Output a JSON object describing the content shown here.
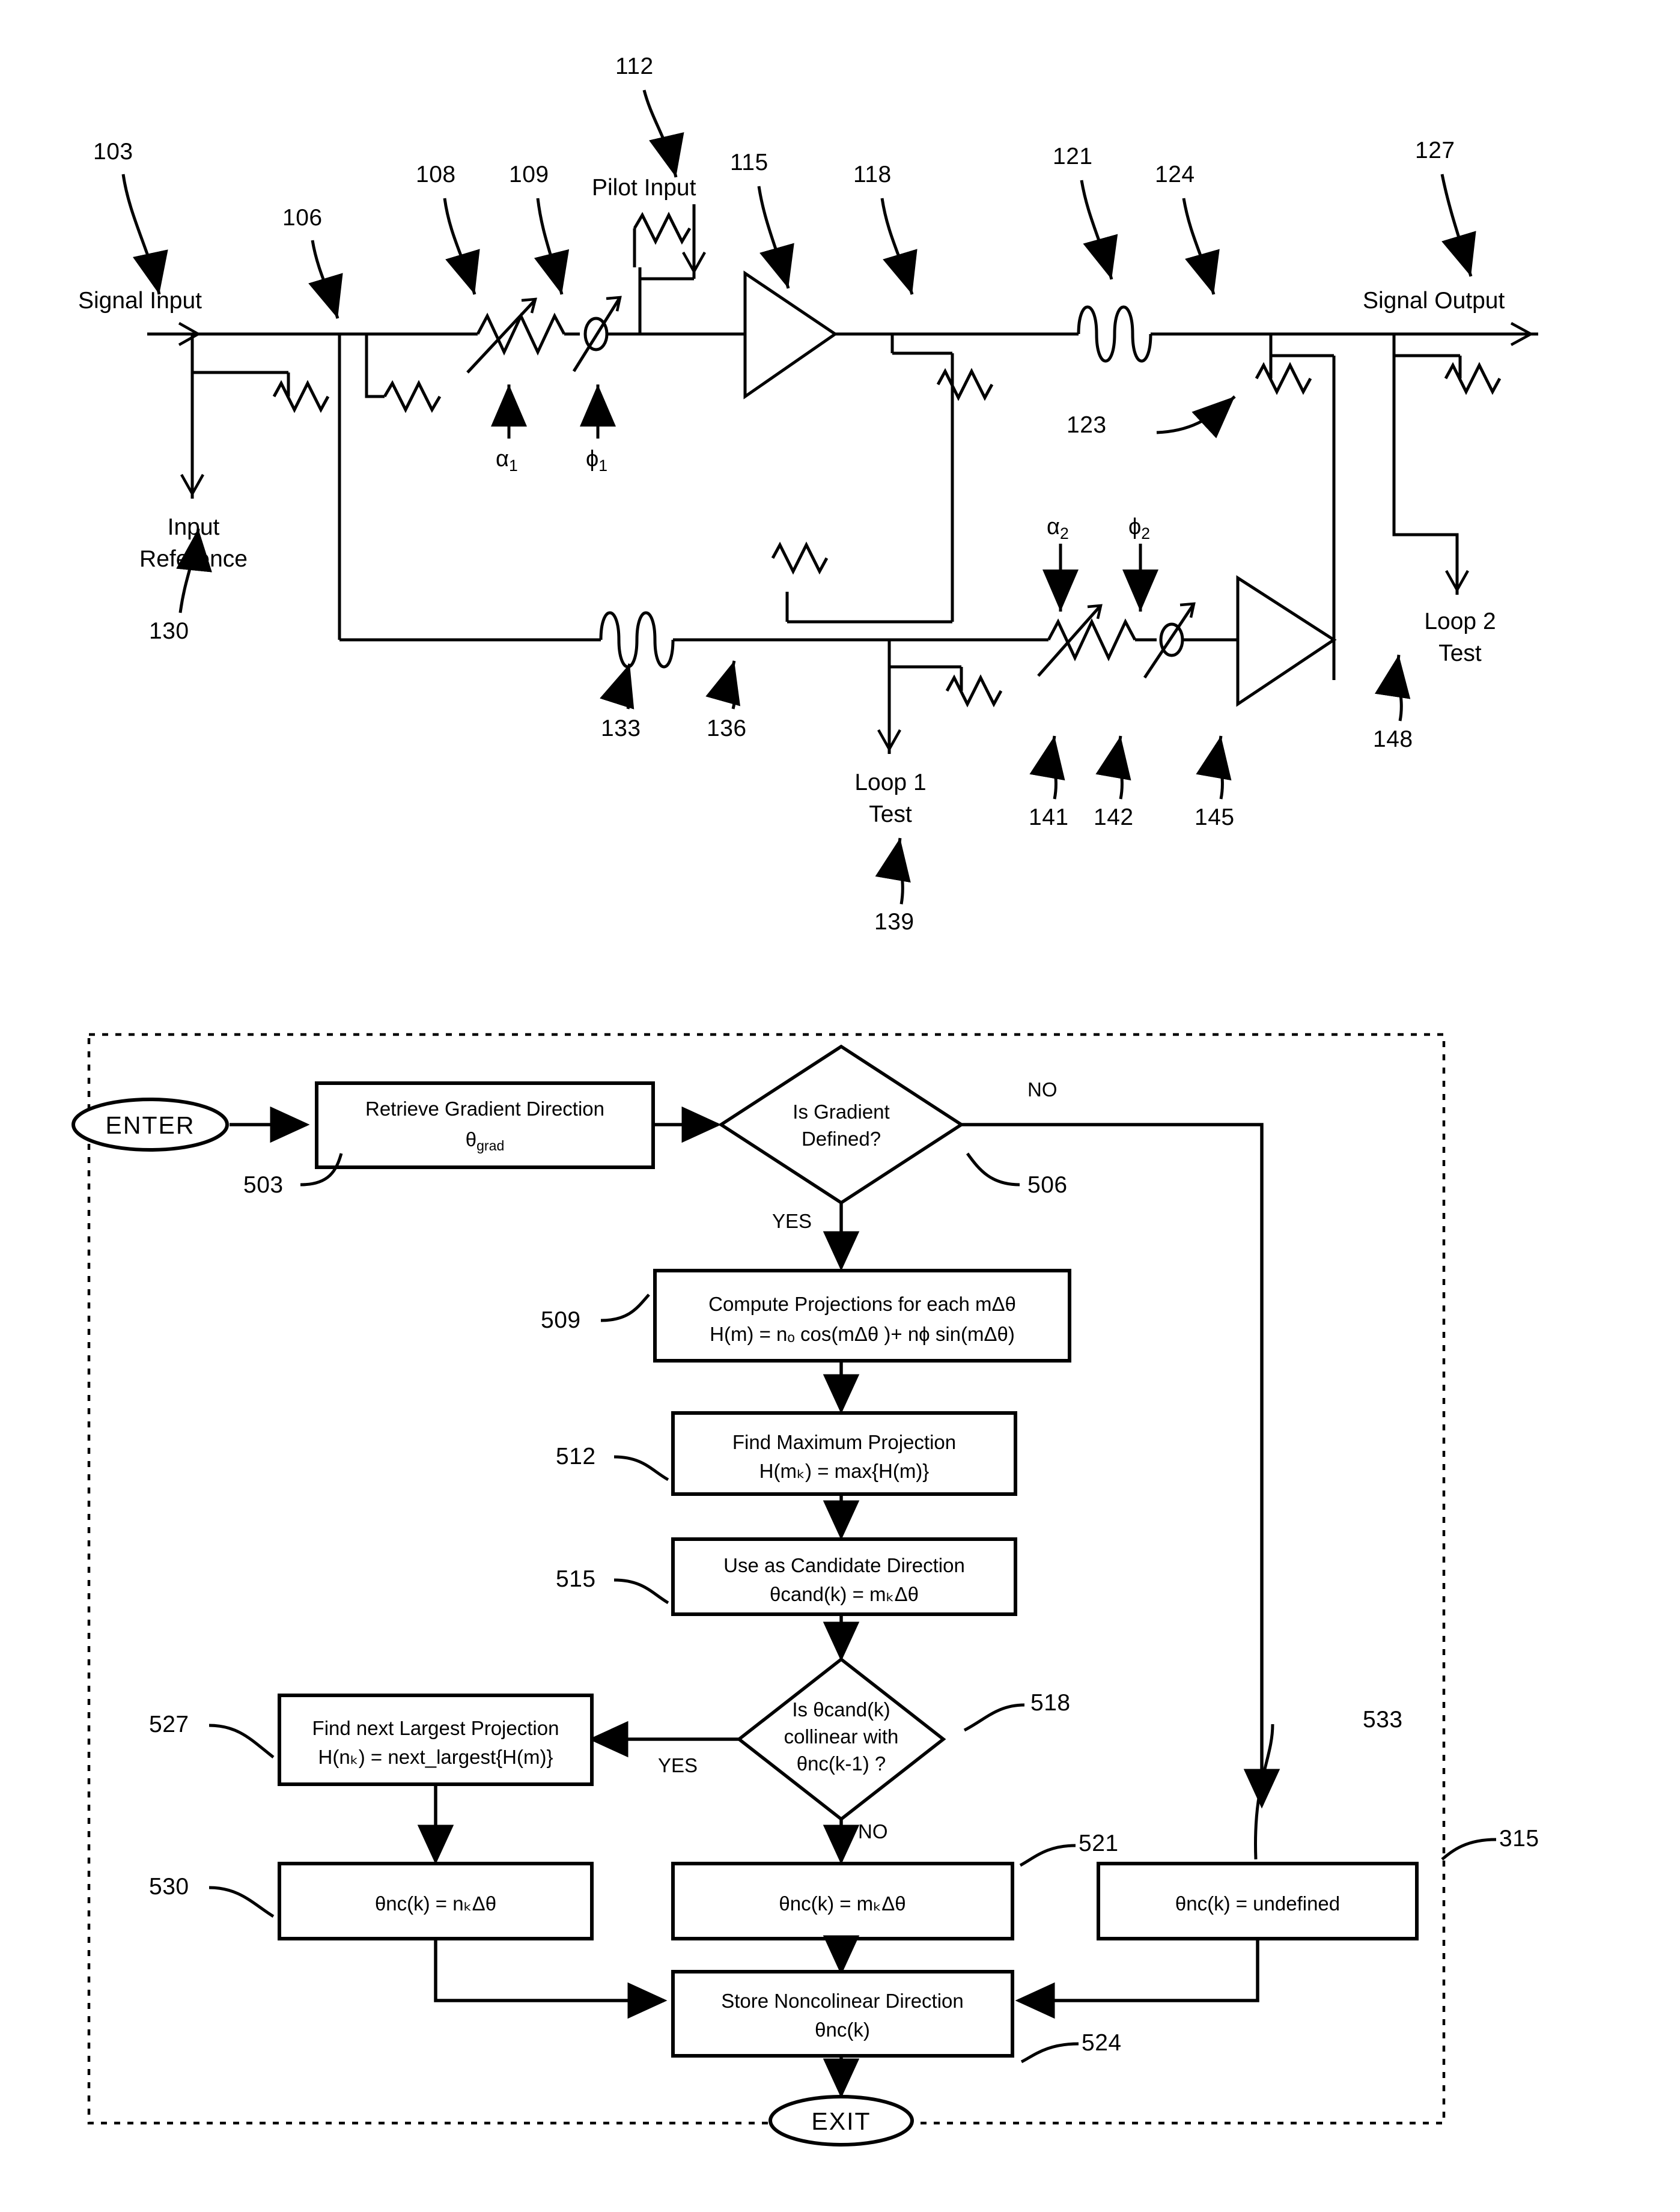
{
  "figure1": {
    "name": "feedforward-amplifier-circuit",
    "terminals": {
      "signal_input": "Signal Input",
      "signal_output": "Signal Output",
      "pilot_input": "Pilot Input",
      "input_reference": "Input\nReference",
      "loop1_test": "Loop 1\nTest",
      "loop2_test": "Loop 2\nTest"
    },
    "terminal_lines": {
      "input_reference_l1": "Input",
      "input_reference_l2": "Reference",
      "loop1_test_l1": "Loop 1",
      "loop1_test_l2": "Test",
      "loop2_test_l1": "Loop 2",
      "loop2_test_l2": "Test"
    },
    "symbols": {
      "alpha1": "α",
      "alpha1_sub": "1",
      "phi1": "ϕ",
      "phi1_sub": "1",
      "alpha2": "α",
      "alpha2_sub": "2",
      "phi2": "ϕ",
      "phi2_sub": "2"
    },
    "refs": [
      {
        "id": "103",
        "label": "103"
      },
      {
        "id": "106",
        "label": "106"
      },
      {
        "id": "108",
        "label": "108"
      },
      {
        "id": "109",
        "label": "109"
      },
      {
        "id": "112",
        "label": "112"
      },
      {
        "id": "115",
        "label": "115"
      },
      {
        "id": "118",
        "label": "118"
      },
      {
        "id": "121",
        "label": "121"
      },
      {
        "id": "123",
        "label": "123"
      },
      {
        "id": "124",
        "label": "124"
      },
      {
        "id": "127",
        "label": "127"
      },
      {
        "id": "130",
        "label": "130"
      },
      {
        "id": "133",
        "label": "133"
      },
      {
        "id": "136",
        "label": "136"
      },
      {
        "id": "139",
        "label": "139"
      },
      {
        "id": "141",
        "label": "141"
      },
      {
        "id": "142",
        "label": "142"
      },
      {
        "id": "145",
        "label": "145"
      },
      {
        "id": "148",
        "label": "148"
      }
    ]
  },
  "figure2": {
    "name": "noncolinear-direction-flowchart",
    "enter_label": "ENTER",
    "exit_label": "EXIT",
    "nodes": {
      "retrieve_gradient": {
        "line1": "Retrieve Gradient Direction",
        "line2_pre": "θ",
        "line2_sub": "grad",
        "ref": "503"
      },
      "is_gradient_defined": {
        "line1": "Is Gradient",
        "line2": "Defined?",
        "ref": "506"
      },
      "compute_projections": {
        "line1": "Compute Projections for each mΔθ",
        "line2": "H(m) = nₒ cos(mΔθ )+ nϕ sin(mΔθ)",
        "ref": "509"
      },
      "find_maximum_projection": {
        "line1": "Find Maximum Projection",
        "line2": "H(mₖ) = max{H(m)}",
        "ref": "512"
      },
      "use_as_candidate": {
        "line1": "Use as Candidate Direction",
        "line2": "θcand(k) = mₖΔθ",
        "ref": "515"
      },
      "is_collinear": {
        "line1": "Is θcand(k)",
        "line2": "collinear with",
        "line3": "θnc(k-1) ?",
        "ref": "518"
      },
      "find_next_largest": {
        "line1": "Find next Largest Projection",
        "line2": "H(nₖ) = next_largest{H(m)}",
        "ref": "527"
      },
      "theta_nc_nk": {
        "line1": "θnc(k) = nₖΔθ",
        "ref": "530"
      },
      "theta_nc_mk": {
        "line1": "θnc(k) = mₖΔθ",
        "ref": "521"
      },
      "theta_nc_undefined": {
        "line1": "θnc(k) = undefined",
        "ref": "533"
      },
      "store_noncolinear": {
        "line1": "Store Noncolinear Direction",
        "line2": "θnc(k)",
        "ref": "524"
      }
    },
    "branch_labels": {
      "no_top": "NO",
      "yes_top": "YES",
      "yes_mid": "YES",
      "no_mid": "NO"
    },
    "container_ref": "315"
  }
}
